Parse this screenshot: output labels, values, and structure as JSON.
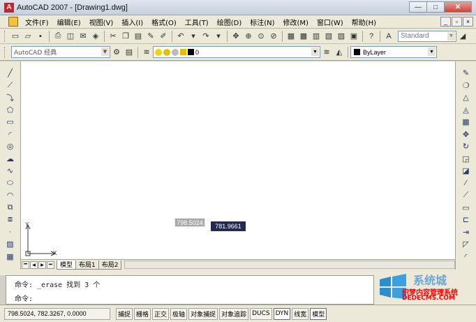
{
  "window": {
    "title": "AutoCAD 2007 - [Drawing1.dwg]",
    "controls": [
      "—",
      "□",
      "✕"
    ]
  },
  "menu": {
    "items": [
      "文件(F)",
      "编辑(E)",
      "视图(V)",
      "插入(I)",
      "格式(O)",
      "工具(T)",
      "绘图(D)",
      "标注(N)",
      "修改(M)",
      "窗口(W)",
      "帮助(H)"
    ],
    "doc_controls": [
      "_",
      "▫",
      "×"
    ]
  },
  "toolbar1": {
    "text_style": "Standard"
  },
  "toolbar2": {
    "workspace": "AutoCAD 经典",
    "layer": "0",
    "color": "ByLayer"
  },
  "canvas": {
    "ucs_x": "X",
    "ucs_y": "Y",
    "tooltip_x": "798.5024",
    "tooltip_y": "781.9661"
  },
  "layout_tabs": [
    "模型",
    "布局1",
    "布局2"
  ],
  "command": {
    "line1": "命令: _erase 找到 3 个",
    "line2": "命令:"
  },
  "status": {
    "coords": "798.5024, 782.3267, 0.0000",
    "buttons": [
      {
        "label": "捕捉",
        "on": false
      },
      {
        "label": "栅格",
        "on": false
      },
      {
        "label": "正交",
        "on": false
      },
      {
        "label": "极轴",
        "on": false
      },
      {
        "label": "对象捕捉",
        "on": false
      },
      {
        "label": "对象追踪",
        "on": false
      },
      {
        "label": "DUCS",
        "on": false
      },
      {
        "label": "DYN",
        "on": true
      },
      {
        "label": "线宽",
        "on": false
      },
      {
        "label": "模型",
        "on": true
      }
    ]
  },
  "watermark": {
    "site": "系统城",
    "text1": "织梦内容管理系统",
    "text2": "DEDECMS.COM"
  },
  "colors": {
    "layer_bulb": "#f2d400",
    "layer_sun": "#e6c000",
    "layer_color": "#000000",
    "tooltip_dark": "#242a52"
  }
}
